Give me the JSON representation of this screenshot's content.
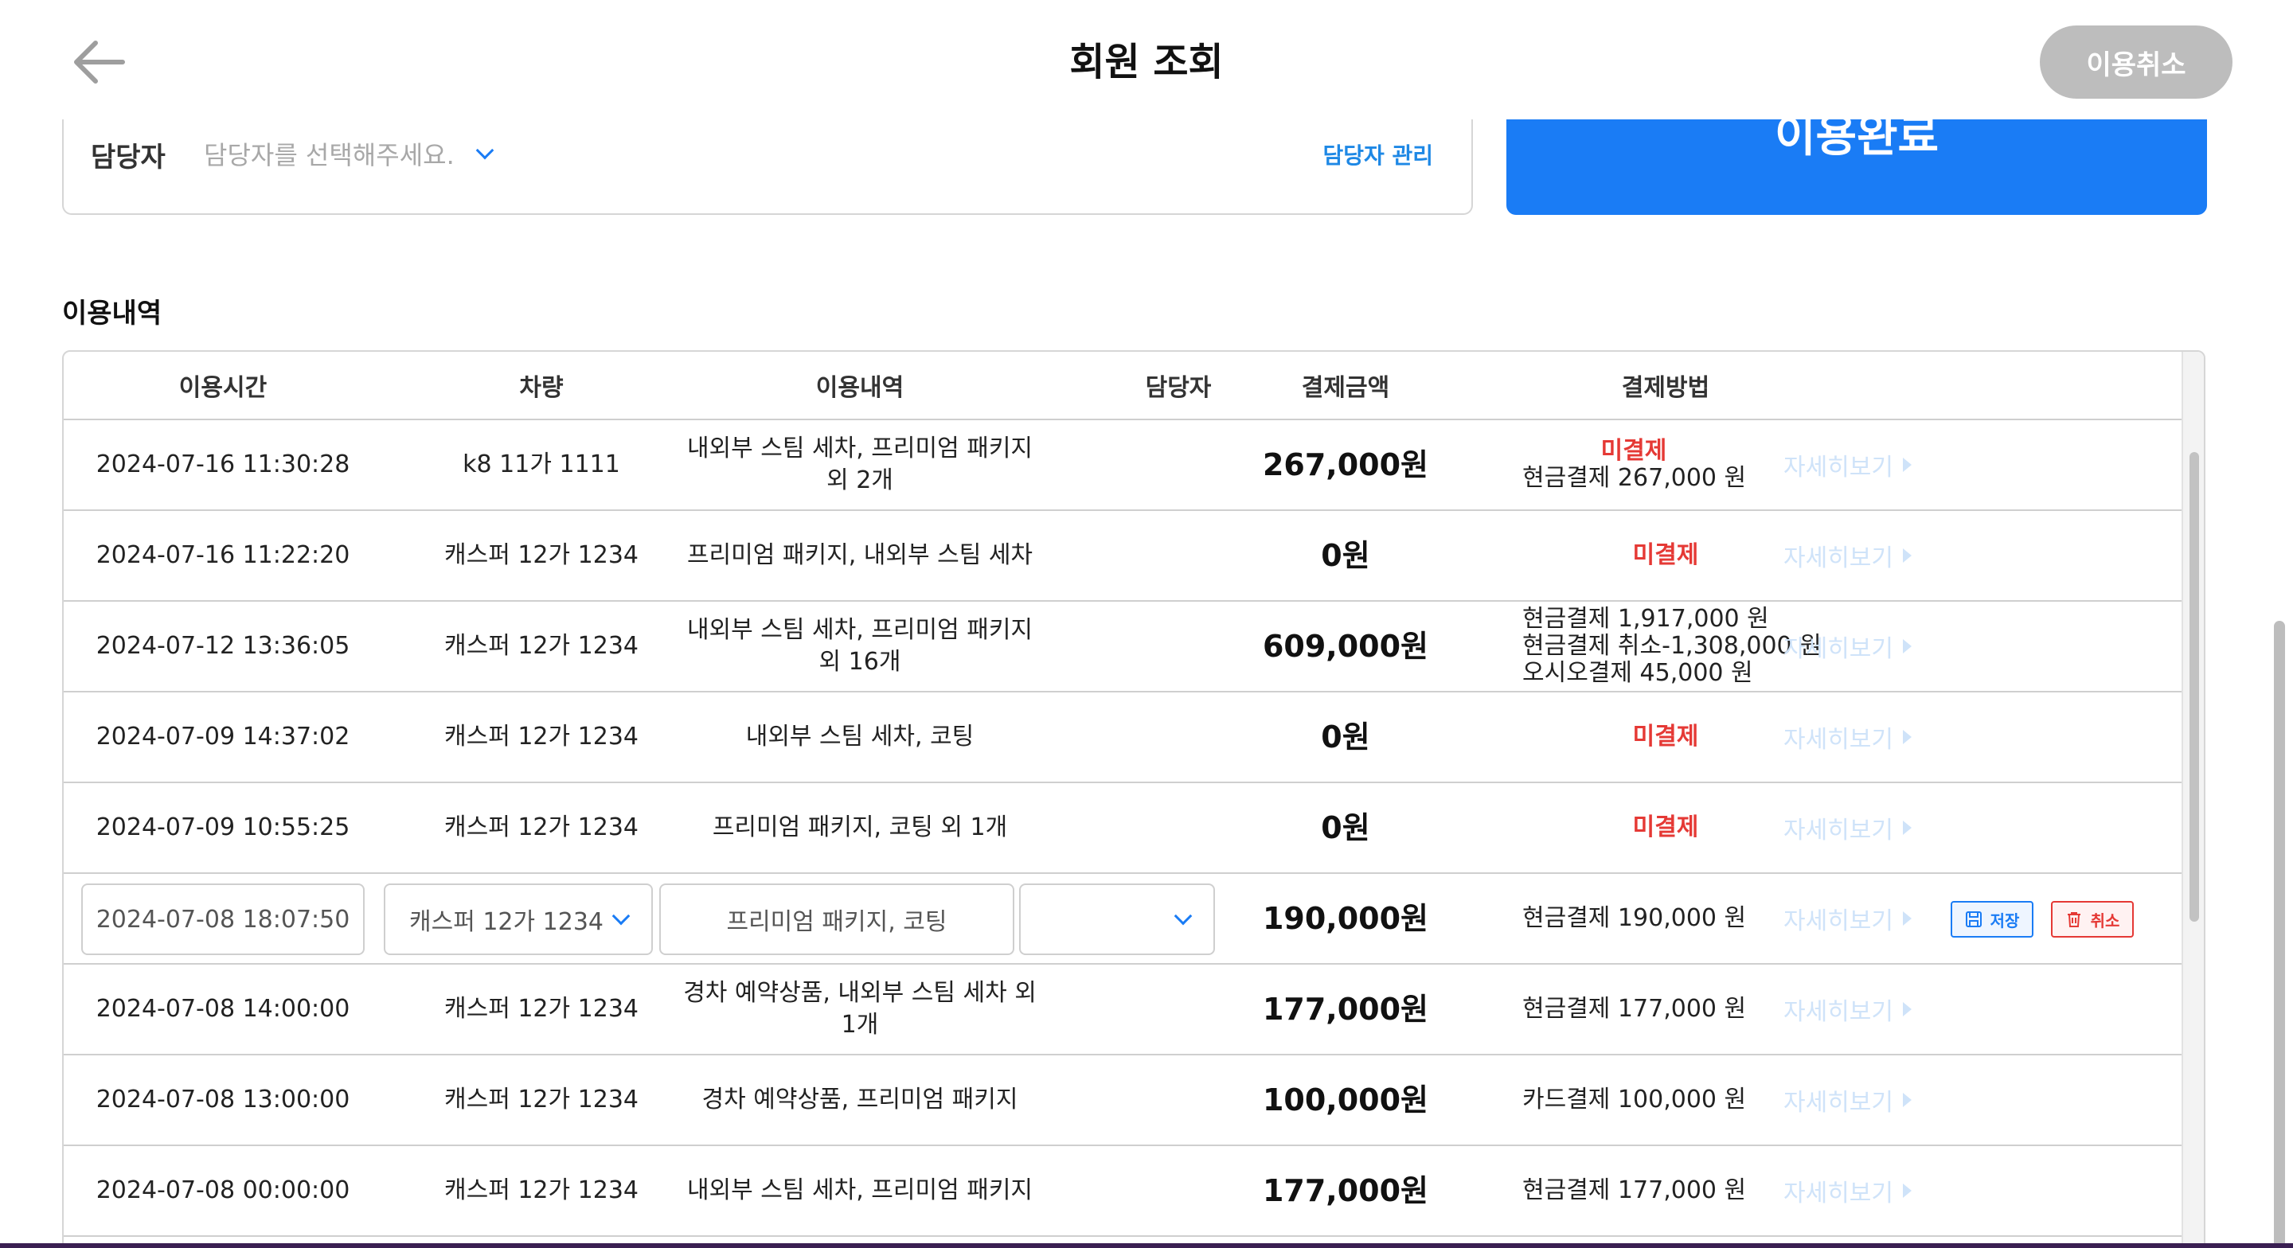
{
  "header": {
    "title": "회원 조회",
    "cancel_use_label": "이용취소"
  },
  "staff": {
    "label": "담당자",
    "placeholder": "담당자를 선택해주세요.",
    "manage_label": "담당자 관리"
  },
  "complete_label": "이용완료",
  "history": {
    "title": "이용내역",
    "columns": [
      "이용시간",
      "차량",
      "이용내역",
      "담당자",
      "결제금액",
      "결제방법"
    ],
    "detail_label": "자세히보기",
    "rows": [
      {
        "time": "2024-07-16 11:30:28",
        "car": "k8 11가 1111",
        "desc": "내외부 스팀 세차, 프리미엄 패키지 외 2개",
        "amount": "267,000원",
        "pay_status": "미결제",
        "pay_lines": [
          "현금결제 267,000 원"
        ]
      },
      {
        "time": "2024-07-16 11:22:20",
        "car": "캐스퍼 12가 1234",
        "desc": "프리미엄 패키지, 내외부 스팀 세차",
        "amount": "0원",
        "pay_status": "미결제",
        "pay_lines": []
      },
      {
        "time": "2024-07-12 13:36:05",
        "car": "캐스퍼 12가 1234",
        "desc": "내외부 스팀 세차, 프리미엄 패키지 외 16개",
        "amount": "609,000원",
        "pay_status": "",
        "pay_lines": [
          "현금결제 1,917,000 원",
          "현금결제 취소-1,308,000 원",
          "오시오결제 45,000 원"
        ]
      },
      {
        "time": "2024-07-09 14:37:02",
        "car": "캐스퍼 12가 1234",
        "desc": "내외부 스팀 세차, 코팅",
        "amount": "0원",
        "pay_status": "미결제",
        "pay_lines": []
      },
      {
        "time": "2024-07-09 10:55:25",
        "car": "캐스퍼 12가 1234",
        "desc": "프리미엄 패키지, 코팅 외 1개",
        "amount": "0원",
        "pay_status": "미결제",
        "pay_lines": []
      },
      {
        "time": "2024-07-08 18:07:50",
        "car": "캐스퍼 12가 1234",
        "desc": "프리미엄 패키지, 코팅",
        "amount": "190,000원",
        "pay_status": "",
        "pay_lines": [
          "현금결제 190,000 원"
        ],
        "editing": true,
        "save_label": "저장",
        "cancel_label": "취소"
      },
      {
        "time": "2024-07-08 14:00:00",
        "car": "캐스퍼 12가 1234",
        "desc": "경차 예약상품, 내외부 스팀 세차 외 1개",
        "amount": "177,000원",
        "pay_status": "",
        "pay_lines": [
          "현금결제 177,000 원"
        ]
      },
      {
        "time": "2024-07-08 13:00:00",
        "car": "캐스퍼 12가 1234",
        "desc": "경차 예약상품, 프리미엄 패키지",
        "amount": "100,000원",
        "pay_status": "",
        "pay_lines": [
          "카드결제 100,000 원"
        ]
      },
      {
        "time": "2024-07-08 00:00:00",
        "car": "캐스퍼 12가 1234",
        "desc": "내외부 스팀 세차, 프리미엄 패키지",
        "amount": "177,000원",
        "pay_status": "",
        "pay_lines": [
          "현금결제 177,000 원"
        ]
      }
    ]
  },
  "colors": {
    "primary": "#1a7cf5",
    "unpaid": "#e53935",
    "detail_link": "#cfe3f9",
    "disabled_button": "#bdbdbd"
  }
}
